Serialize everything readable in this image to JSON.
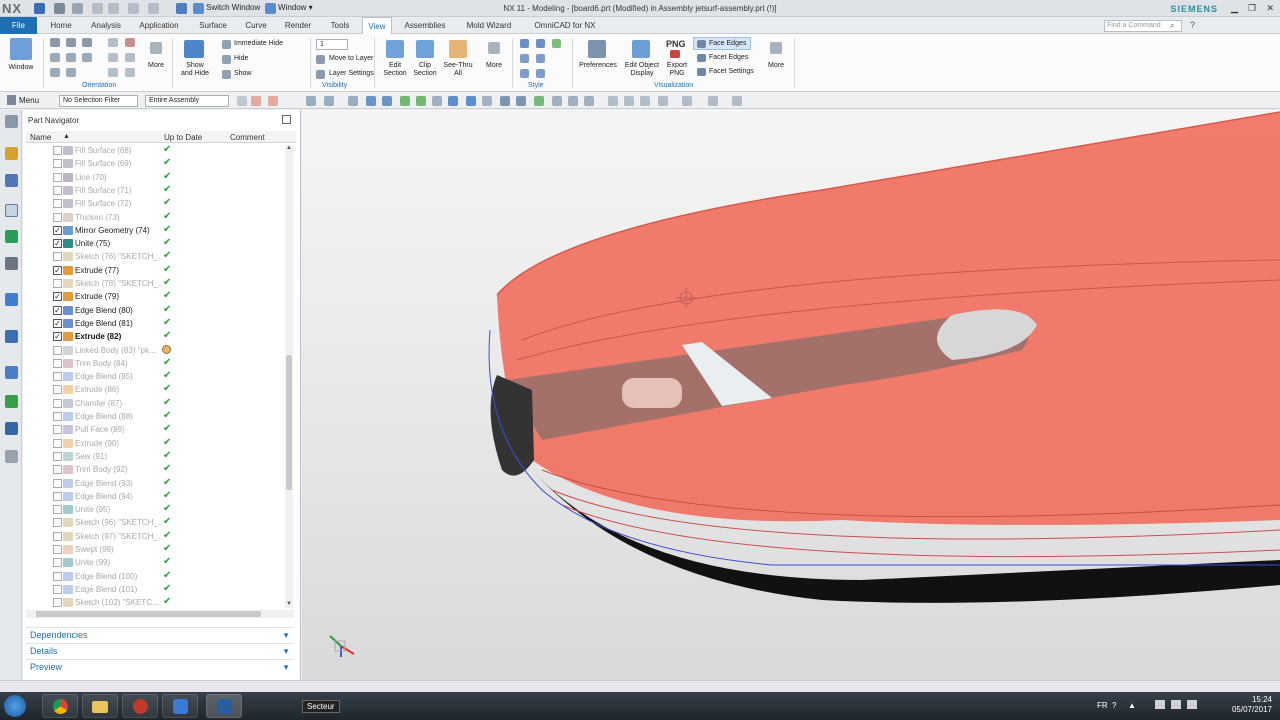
{
  "titlebar": {
    "logo": "NX",
    "switch_window": "Switch Window",
    "window_menu": "Window ▾",
    "title": "NX 11 - Modeling - [board6.prt (Modified)  in Assembly jetsurf-assembly.prt  (!)]",
    "brand": "SIEMENS"
  },
  "tabs": [
    "File",
    "Home",
    "Analysis",
    "Application",
    "Surface",
    "Curve",
    "Render",
    "Tools",
    "View",
    "Assemblies",
    "Mold Wizard",
    "OmniCAD for NX"
  ],
  "active_tab": "View",
  "command_search_placeholder": "Find a Command",
  "ribbon": {
    "window": "Window",
    "more1": "More",
    "show_hide": "Show\nand Hide",
    "immediate_hide": "Immediate Hide",
    "hide": "Hide",
    "show": "Show",
    "layer_value": "1",
    "move_to_layer": "Move to Layer",
    "layer_settings": "Layer Settings",
    "edit_section": "Edit\nSection",
    "clip_section": "Clip\nSection",
    "see_thru_all": "See-Thru\nAll",
    "more2": "More",
    "preferences": "Preferences",
    "edit_object_display": "Edit Object\nDisplay",
    "export_png": "Export\nPNG",
    "png": "PNG",
    "face_edges": "Face Edges",
    "facet_edges": "Facet Edges",
    "facet_settings": "Facet Settings",
    "more3": "More",
    "groups": {
      "orientation": "Orientation",
      "visibility": "Visibility",
      "style": "Style",
      "visualization": "Visualization"
    }
  },
  "toolbar2": {
    "menu": "Menu",
    "selection_filter": "No Selection Filter",
    "scope": "Entire Assembly"
  },
  "navigator": {
    "title": "Part Navigator",
    "columns": {
      "name": "Name",
      "up_to_date": "Up to Date",
      "comment": "Comment"
    },
    "rows": [
      {
        "label": "Fill Surface (68)",
        "state": "ghost",
        "icon": "fill-surface",
        "status": "ok"
      },
      {
        "label": "Fill Surface (69)",
        "state": "ghost",
        "icon": "fill-surface",
        "status": "ok"
      },
      {
        "label": "Line (70)",
        "state": "ghost",
        "icon": "line",
        "status": "ok"
      },
      {
        "label": "Fill Surface (71)",
        "state": "ghost",
        "icon": "fill-surface",
        "status": "ok"
      },
      {
        "label": "Fill Surface (72)",
        "state": "ghost",
        "icon": "fill-surface",
        "status": "ok"
      },
      {
        "label": "Thicken (73)",
        "state": "ghost",
        "icon": "thicken",
        "status": "ok"
      },
      {
        "label": "Mirror Geometry (74)",
        "state": "normal",
        "icon": "mirror",
        "status": "ok"
      },
      {
        "label": "Unite (75)",
        "state": "normal",
        "icon": "unite",
        "status": "ok"
      },
      {
        "label": "Sketch (76) \"SKETCH_...",
        "state": "ghost",
        "icon": "sketch",
        "status": "ok"
      },
      {
        "label": "Extrude (77)",
        "state": "normal",
        "icon": "extrude",
        "status": "ok"
      },
      {
        "label": "Sketch (78) \"SKETCH_...",
        "state": "ghost",
        "icon": "sketch",
        "status": "ok"
      },
      {
        "label": "Extrude (79)",
        "state": "normal",
        "icon": "extrude",
        "status": "ok"
      },
      {
        "label": "Edge Blend (80)",
        "state": "normal",
        "icon": "edge-blend",
        "status": "ok"
      },
      {
        "label": "Edge Blend (81)",
        "state": "normal",
        "icon": "edge-blend",
        "status": "ok"
      },
      {
        "label": "Extrude (82)",
        "state": "bold",
        "icon": "extrude",
        "status": "ok"
      },
      {
        "label": "Linked Body (83) \"pk...",
        "state": "ghost",
        "icon": "linked-body",
        "status": "warn"
      },
      {
        "label": "Trim Body (84)",
        "state": "ghost",
        "icon": "trim-body",
        "status": "ok"
      },
      {
        "label": "Edge Blend (85)",
        "state": "ghost",
        "icon": "edge-blend",
        "status": "ok"
      },
      {
        "label": "Extrude (86)",
        "state": "ghost",
        "icon": "extrude",
        "status": "ok"
      },
      {
        "label": "Chamfer (87)",
        "state": "ghost",
        "icon": "chamfer",
        "status": "ok"
      },
      {
        "label": "Edge Blend (88)",
        "state": "ghost",
        "icon": "edge-blend",
        "status": "ok"
      },
      {
        "label": "Pull Face (89)",
        "state": "ghost",
        "icon": "pull-face",
        "status": "ok"
      },
      {
        "label": "Extrude (90)",
        "state": "ghost",
        "icon": "extrude",
        "status": "ok"
      },
      {
        "label": "Sew (91)",
        "state": "ghost",
        "icon": "sew",
        "status": "ok"
      },
      {
        "label": "Trim Body (92)",
        "state": "ghost",
        "icon": "trim-body",
        "status": "ok"
      },
      {
        "label": "Edge Blend (93)",
        "state": "ghost",
        "icon": "edge-blend",
        "status": "ok"
      },
      {
        "label": "Edge Blend (94)",
        "state": "ghost",
        "icon": "edge-blend",
        "status": "ok"
      },
      {
        "label": "Unite (95)",
        "state": "ghost",
        "icon": "unite",
        "status": "ok"
      },
      {
        "label": "Sketch (96) \"SKETCH_...",
        "state": "ghost",
        "icon": "sketch",
        "status": "ok"
      },
      {
        "label": "Sketch (97) \"SKETCH_...",
        "state": "ghost",
        "icon": "sketch",
        "status": "ok"
      },
      {
        "label": "Swept (98)",
        "state": "ghost",
        "icon": "swept",
        "status": "ok"
      },
      {
        "label": "Unite (99)",
        "state": "ghost",
        "icon": "unite",
        "status": "ok"
      },
      {
        "label": "Edge Blend (100)",
        "state": "ghost",
        "icon": "edge-blend",
        "status": "ok"
      },
      {
        "label": "Edge Blend (101)",
        "state": "ghost",
        "icon": "edge-blend",
        "status": "ok"
      },
      {
        "label": "Sketch (102) \"SKETC...",
        "state": "ghost",
        "icon": "sketch",
        "status": "ok"
      }
    ],
    "sections": [
      "Dependencies",
      "Details",
      "Preview"
    ]
  },
  "colors": {
    "accent": "#1e6fb6",
    "model": "#f0705f",
    "check": "#2e9e3e"
  },
  "taskbar": {
    "window_label": "Secteur",
    "language": "FR",
    "time": "15:24",
    "date": "05/07/2017"
  }
}
